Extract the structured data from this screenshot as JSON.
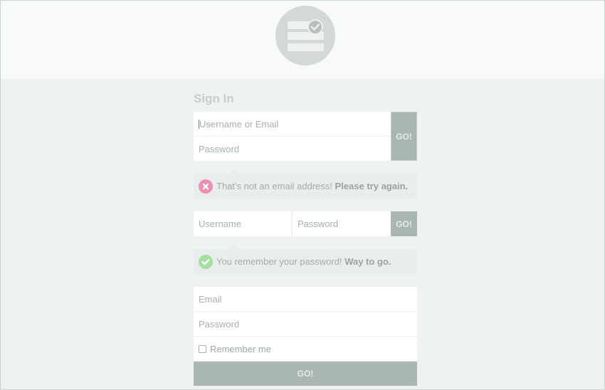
{
  "logo": {
    "icon": "form-check-icon"
  },
  "signin": {
    "title": "Sign In"
  },
  "form1": {
    "username_placeholder": "Username or Email",
    "password_placeholder": "Password",
    "go_label": "GO!",
    "error_text": "That's not an email address!",
    "error_strong": "Please try again."
  },
  "form2": {
    "username_placeholder": "Username",
    "password_placeholder": "Password",
    "go_label": "GO!",
    "success_text": "You remember your password!",
    "success_strong": "Way to go."
  },
  "form3": {
    "email_placeholder": "Email",
    "password_placeholder": "Password",
    "remember_label": "Remember me",
    "go_label": "GO!"
  },
  "colors": {
    "error": "#ec8fb4",
    "success": "#a6dea0",
    "button": "#a9b6b3"
  }
}
